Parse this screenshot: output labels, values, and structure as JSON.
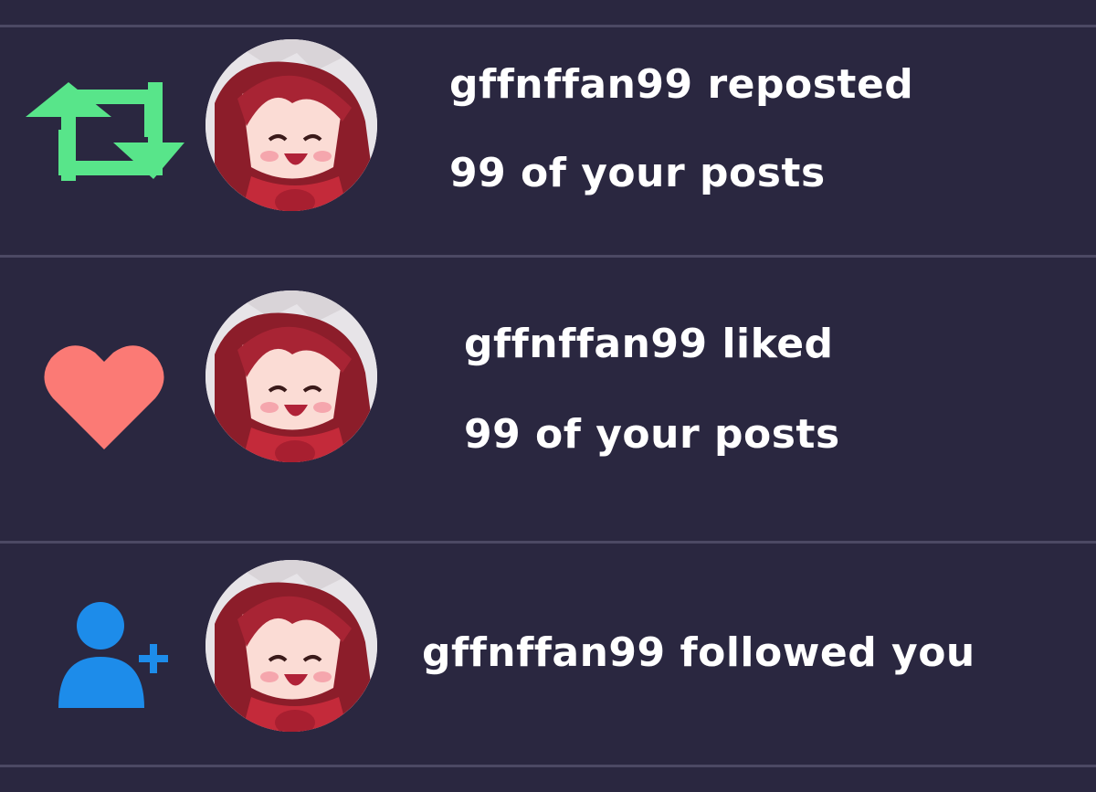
{
  "colors": {
    "background": "#2a2740",
    "divider": "#4c4964",
    "repost": "#58e58a",
    "like": "#fb7a75",
    "follow": "#1d8cea",
    "text": "#ffffff"
  },
  "notifications": [
    {
      "type": "repost",
      "icon": "repost-icon",
      "line1": "gffnffan99 reposted",
      "line2": "99 of your posts"
    },
    {
      "type": "like",
      "icon": "heart-icon",
      "line1": "gffnffan99 liked",
      "line2": "99 of your posts"
    },
    {
      "type": "follow",
      "icon": "follow-user-icon",
      "line1": "gffnffan99 followed you"
    }
  ]
}
